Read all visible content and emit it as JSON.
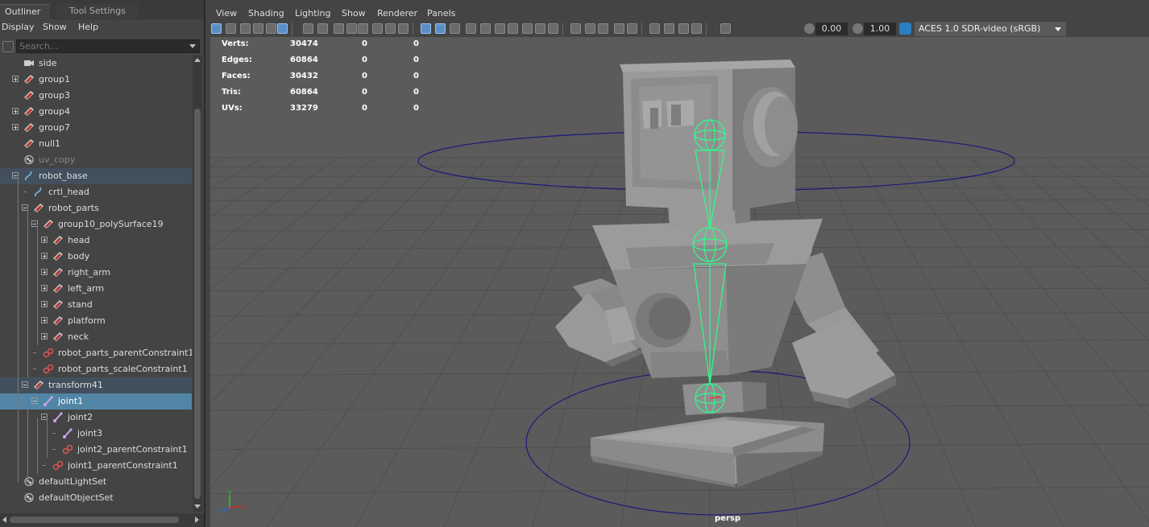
{
  "outliner": {
    "tabs": [
      "Outliner",
      "Tool Settings"
    ],
    "menu": [
      "Display",
      "Show",
      "Help"
    ],
    "search_placeholder": "Search...",
    "items": [
      {
        "label": "side",
        "depth": 0,
        "expand": "none",
        "icon": "camera-icon",
        "state": ""
      },
      {
        "label": "group1",
        "depth": 0,
        "expand": "plus",
        "icon": "transform-icon",
        "state": ""
      },
      {
        "label": "group3",
        "depth": 0,
        "expand": "none",
        "icon": "transform-icon",
        "state": ""
      },
      {
        "label": "group4",
        "depth": 0,
        "expand": "plus",
        "icon": "transform-icon",
        "state": ""
      },
      {
        "label": "group7",
        "depth": 0,
        "expand": "plus",
        "icon": "transform-icon",
        "state": ""
      },
      {
        "label": "null1",
        "depth": 0,
        "expand": "none",
        "icon": "transform-icon",
        "state": ""
      },
      {
        "label": "uv_copy",
        "depth": 0,
        "expand": "none",
        "icon": "set-icon",
        "state": "dim"
      },
      {
        "label": "robot_base",
        "depth": 0,
        "expand": "minus",
        "icon": "curve-icon",
        "state": "sel-dark"
      },
      {
        "label": "crtl_head",
        "depth": 1,
        "expand": "none",
        "icon": "curve-icon",
        "state": ""
      },
      {
        "label": "robot_parts",
        "depth": 1,
        "expand": "minus",
        "icon": "transform-icon",
        "state": ""
      },
      {
        "label": "group10_polySurface19",
        "depth": 2,
        "expand": "minus",
        "icon": "transform-icon",
        "state": ""
      },
      {
        "label": "head",
        "depth": 3,
        "expand": "plus",
        "icon": "transform-icon",
        "state": ""
      },
      {
        "label": "body",
        "depth": 3,
        "expand": "plus",
        "icon": "transform-icon",
        "state": ""
      },
      {
        "label": "right_arm",
        "depth": 3,
        "expand": "plus",
        "icon": "transform-icon",
        "state": ""
      },
      {
        "label": "left_arm",
        "depth": 3,
        "expand": "plus",
        "icon": "transform-icon",
        "state": ""
      },
      {
        "label": "stand",
        "depth": 3,
        "expand": "plus",
        "icon": "transform-icon",
        "state": ""
      },
      {
        "label": "platform",
        "depth": 3,
        "expand": "plus",
        "icon": "transform-icon",
        "state": ""
      },
      {
        "label": "neck",
        "depth": 3,
        "expand": "plus",
        "icon": "transform-icon",
        "state": ""
      },
      {
        "label": "robot_parts_parentConstraint1",
        "depth": 2,
        "expand": "none",
        "icon": "constraint-icon",
        "state": ""
      },
      {
        "label": "robot_parts_scaleConstraint1",
        "depth": 2,
        "expand": "none",
        "icon": "constraint-icon",
        "state": ""
      },
      {
        "label": "transform41",
        "depth": 1,
        "expand": "minus",
        "icon": "transform-icon",
        "state": "sel-dark"
      },
      {
        "label": "joint1",
        "depth": 2,
        "expand": "minus",
        "icon": "joint-icon",
        "state": "sel"
      },
      {
        "label": "joint2",
        "depth": 3,
        "expand": "minus",
        "icon": "joint-icon",
        "state": ""
      },
      {
        "label": "joint3",
        "depth": 4,
        "expand": "none",
        "icon": "joint-icon",
        "state": ""
      },
      {
        "label": "joint2_parentConstraint1",
        "depth": 4,
        "expand": "none",
        "icon": "constraint-icon",
        "state": ""
      },
      {
        "label": "joint1_parentConstraint1",
        "depth": 3,
        "expand": "none",
        "icon": "constraint-icon",
        "state": ""
      },
      {
        "label": "defaultLightSet",
        "depth": 0,
        "expand": "none",
        "icon": "set-icon",
        "state": ""
      },
      {
        "label": "defaultObjectSet",
        "depth": 0,
        "expand": "none",
        "icon": "set-icon",
        "state": ""
      }
    ]
  },
  "viewport": {
    "menu": [
      "View",
      "Shading",
      "Lighting",
      "Show",
      "Renderer",
      "Panels"
    ],
    "exposure": "0.00",
    "gamma": "1.00",
    "color_space": "ACES 1.0 SDR-video (sRGB)",
    "camera_label": "persp",
    "hud": [
      {
        "label": "Verts:",
        "values": [
          "30474",
          "0",
          "0"
        ]
      },
      {
        "label": "Edges:",
        "values": [
          "60864",
          "0",
          "0"
        ]
      },
      {
        "label": "Faces:",
        "values": [
          "30432",
          "0",
          "0"
        ]
      },
      {
        "label": "Tris:",
        "values": [
          "60864",
          "0",
          "0"
        ]
      },
      {
        "label": "UVs:",
        "values": [
          "33279",
          "0",
          "0"
        ]
      }
    ],
    "axis_labels": {
      "x": "x",
      "y": "y",
      "z": "z"
    }
  },
  "colors": {
    "selection": "#5285a6",
    "joint_green": "#2bff8a",
    "control_curve": "#1a1a7a",
    "background": "#5b5b5b",
    "mesh": "#8e8e8e"
  }
}
